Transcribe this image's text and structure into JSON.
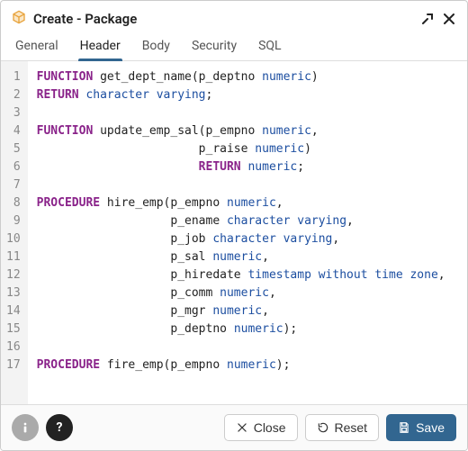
{
  "header": {
    "title": "Create - Package",
    "icon": "package-icon"
  },
  "tabs": [
    {
      "label": "General",
      "active": false
    },
    {
      "label": "Header",
      "active": true
    },
    {
      "label": "Body",
      "active": false
    },
    {
      "label": "Security",
      "active": false
    },
    {
      "label": "SQL",
      "active": false
    }
  ],
  "code": {
    "lines": [
      {
        "n": 1,
        "tokens": [
          {
            "t": "FUNCTION",
            "c": "kw"
          },
          {
            "t": " get_dept_name(p_deptno "
          },
          {
            "t": "numeric",
            "c": "type"
          },
          {
            "t": ")"
          }
        ]
      },
      {
        "n": 2,
        "tokens": [
          {
            "t": "RETURN",
            "c": "kw"
          },
          {
            "t": " "
          },
          {
            "t": "character varying",
            "c": "type"
          },
          {
            "t": ";"
          }
        ]
      },
      {
        "n": 3,
        "tokens": []
      },
      {
        "n": 4,
        "tokens": [
          {
            "t": "FUNCTION",
            "c": "kw"
          },
          {
            "t": " update_emp_sal(p_empno "
          },
          {
            "t": "numeric",
            "c": "type"
          },
          {
            "t": ","
          }
        ]
      },
      {
        "n": 5,
        "tokens": [
          {
            "t": "                       p_raise "
          },
          {
            "t": "numeric",
            "c": "type"
          },
          {
            "t": ")"
          }
        ]
      },
      {
        "n": 6,
        "tokens": [
          {
            "t": "                       "
          },
          {
            "t": "RETURN",
            "c": "kw"
          },
          {
            "t": " "
          },
          {
            "t": "numeric",
            "c": "type"
          },
          {
            "t": ";"
          }
        ]
      },
      {
        "n": 7,
        "tokens": []
      },
      {
        "n": 8,
        "tokens": [
          {
            "t": "PROCEDURE",
            "c": "kw"
          },
          {
            "t": " hire_emp(p_empno "
          },
          {
            "t": "numeric",
            "c": "type"
          },
          {
            "t": ","
          }
        ]
      },
      {
        "n": 9,
        "tokens": [
          {
            "t": "                   p_ename "
          },
          {
            "t": "character varying",
            "c": "type"
          },
          {
            "t": ","
          }
        ]
      },
      {
        "n": 10,
        "tokens": [
          {
            "t": "                   p_job "
          },
          {
            "t": "character varying",
            "c": "type"
          },
          {
            "t": ","
          }
        ]
      },
      {
        "n": 11,
        "tokens": [
          {
            "t": "                   p_sal "
          },
          {
            "t": "numeric",
            "c": "type"
          },
          {
            "t": ","
          }
        ]
      },
      {
        "n": 12,
        "tokens": [
          {
            "t": "                   p_hiredate "
          },
          {
            "t": "timestamp without time zone",
            "c": "type"
          },
          {
            "t": ","
          }
        ]
      },
      {
        "n": 13,
        "tokens": [
          {
            "t": "                   p_comm "
          },
          {
            "t": "numeric",
            "c": "type"
          },
          {
            "t": ","
          }
        ]
      },
      {
        "n": 14,
        "tokens": [
          {
            "t": "                   p_mgr "
          },
          {
            "t": "numeric",
            "c": "type"
          },
          {
            "t": ","
          }
        ]
      },
      {
        "n": 15,
        "tokens": [
          {
            "t": "                   p_deptno "
          },
          {
            "t": "numeric",
            "c": "type"
          },
          {
            "t": ");"
          }
        ]
      },
      {
        "n": 16,
        "tokens": []
      },
      {
        "n": 17,
        "tokens": [
          {
            "t": "PROCEDURE",
            "c": "kw"
          },
          {
            "t": " fire_emp(p_empno "
          },
          {
            "t": "numeric",
            "c": "type"
          },
          {
            "t": ");"
          }
        ]
      }
    ]
  },
  "footer": {
    "info_label": "i",
    "help_label": "?",
    "close_label": "Close",
    "reset_label": "Reset",
    "save_label": "Save"
  }
}
